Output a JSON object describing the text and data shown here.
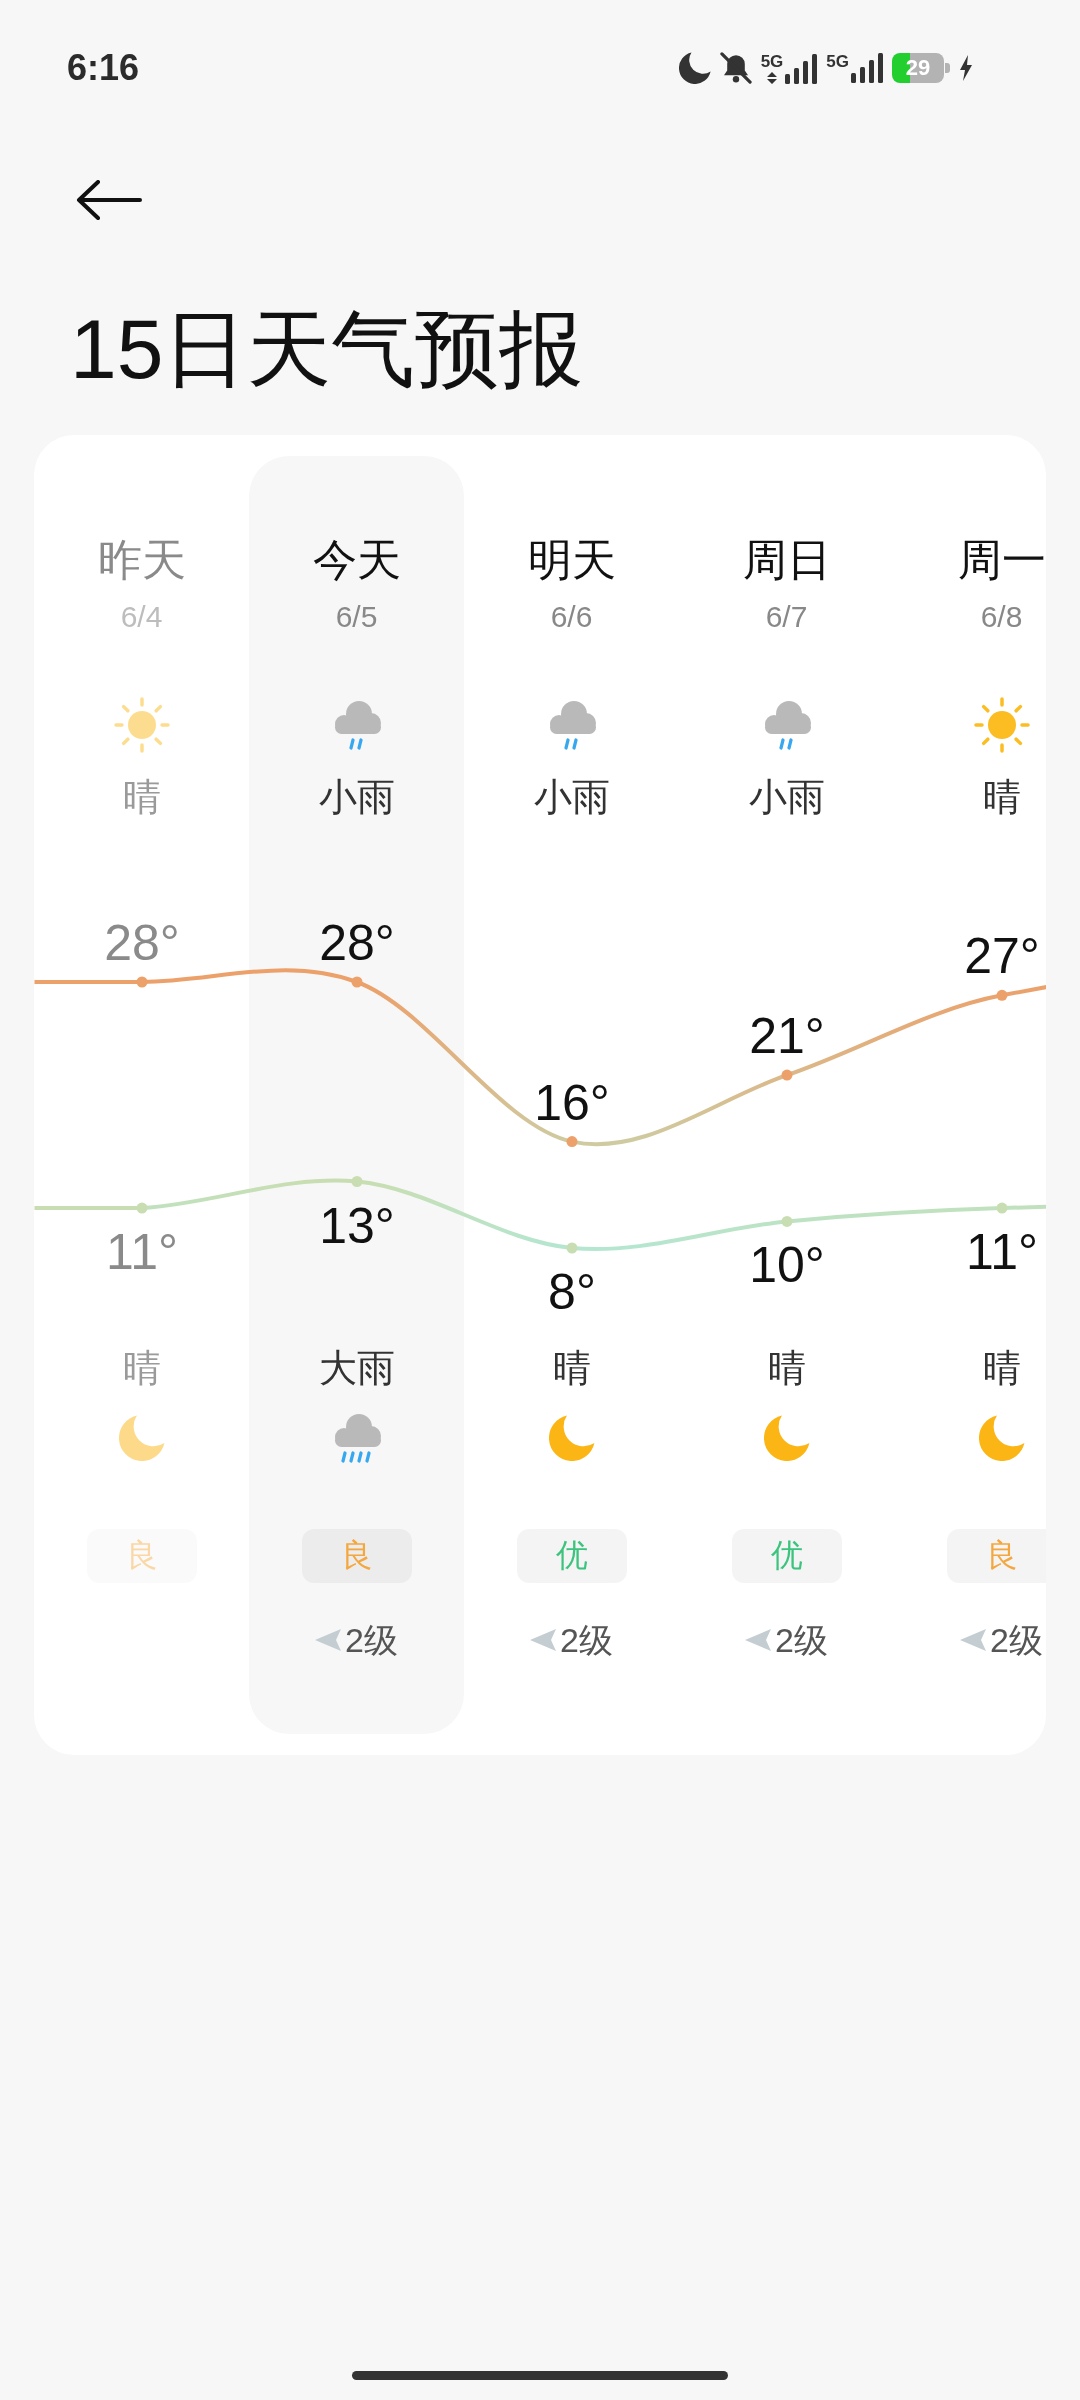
{
  "status_bar": {
    "time": "6:16",
    "sims": [
      {
        "network": "5G",
        "data_active": true
      },
      {
        "network": "5G",
        "data_active": false
      }
    ],
    "battery": "29",
    "charging": true
  },
  "title": "15日天气预报",
  "forecast": {
    "days": [
      {
        "name": "昨天",
        "date": "6/4",
        "selected": false,
        "past": true,
        "day": {
          "kind": "clear",
          "text": "晴"
        },
        "night": {
          "kind": "clear",
          "text": "晴"
        },
        "aqi": {
          "text": "良",
          "color": "#fad7a4"
        }
      },
      {
        "name": "今天",
        "date": "6/5",
        "selected": true,
        "past": false,
        "day": {
          "kind": "light_rain",
          "text": "小雨"
        },
        "night": {
          "kind": "heavy_rain",
          "text": "大雨"
        },
        "aqi": {
          "text": "良",
          "color": "#f4a73f"
        },
        "wind": "2级"
      },
      {
        "name": "明天",
        "date": "6/6",
        "selected": false,
        "past": false,
        "day": {
          "kind": "light_rain",
          "text": "小雨"
        },
        "night": {
          "kind": "clear",
          "text": "晴"
        },
        "aqi": {
          "text": "优",
          "color": "#3cc47e"
        },
        "wind": "2级"
      },
      {
        "name": "周日",
        "date": "6/7",
        "selected": false,
        "past": false,
        "day": {
          "kind": "light_rain",
          "text": "小雨"
        },
        "night": {
          "kind": "clear",
          "text": "晴"
        },
        "aqi": {
          "text": "优",
          "color": "#3cc47e"
        },
        "wind": "2级"
      },
      {
        "name": "周一",
        "date": "6/8",
        "selected": false,
        "past": false,
        "day": {
          "kind": "clear",
          "text": "晴"
        },
        "night": {
          "kind": "clear",
          "text": "晴"
        },
        "aqi": {
          "text": "良",
          "color": "#f4a73f"
        },
        "wind": "2级"
      }
    ],
    "chart_data": {
      "type": "line",
      "categories": [
        null,
        null,
        null,
        null,
        null
      ],
      "data_labels": true,
      "series": [
        {
          "color": "#eca06a",
          "marker": "circle",
          "values": [
            28,
            28,
            16,
            21,
            27
          ],
          "value_labels": [
            "28°",
            "28°",
            "16°",
            "21°",
            "27°"
          ]
        },
        {
          "color": "#c8deb2",
          "marker": "circle",
          "values": [
            11,
            13,
            8,
            10,
            11
          ],
          "value_labels": [
            "11°",
            "13°",
            "8°",
            "10°",
            "11°"
          ]
        }
      ]
    }
  }
}
